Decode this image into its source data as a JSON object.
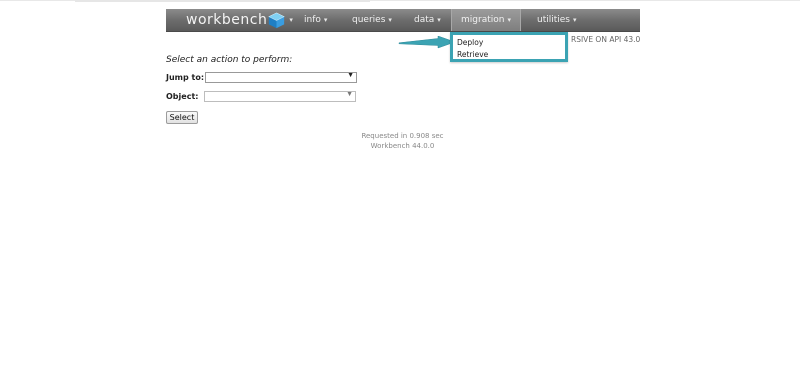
{
  "navbar": {
    "logo_text": "workbench",
    "items": [
      {
        "label": "info"
      },
      {
        "label": "queries"
      },
      {
        "label": "data"
      },
      {
        "label": "migration"
      },
      {
        "label": "utilities"
      }
    ]
  },
  "dropdown": {
    "items": [
      {
        "label": "Deploy"
      },
      {
        "label": "Retrieve"
      }
    ]
  },
  "api_info": "RSIVE ON API 43.0",
  "form": {
    "prompt": "Select an action to perform:",
    "jump_to_label": "Jump to:",
    "jump_to_value": "",
    "object_label": "Object:",
    "object_value": "",
    "select_button": "Select"
  },
  "footer": {
    "request_time": "Requested in 0.908 sec",
    "version": "Workbench 44.0.0"
  },
  "colors": {
    "highlight": "#3ba3b3",
    "navbar": "#6d6d6d"
  }
}
